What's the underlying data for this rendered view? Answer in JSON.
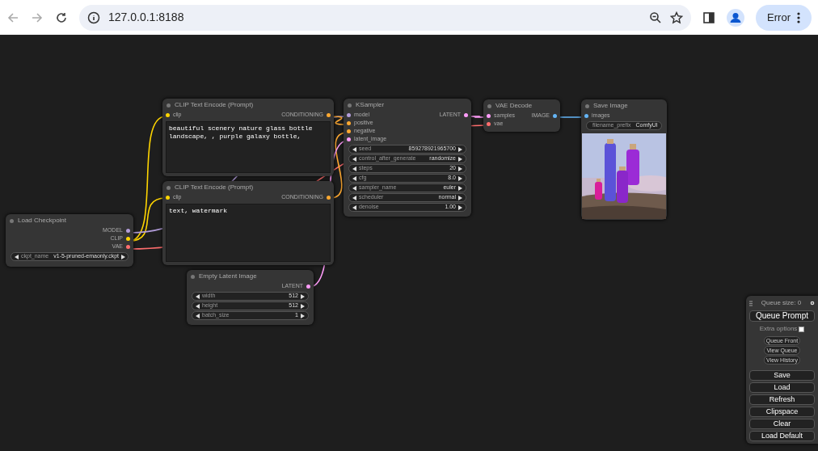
{
  "browser": {
    "url": "127.0.0.1:8188",
    "profile_button": "Error"
  },
  "nodes": [
    {
      "title": "Load Checkpoint",
      "outputs": [
        {
          "label": "MODEL",
          "color": "#b39ddb"
        },
        {
          "label": "CLIP",
          "color": "#ffd500"
        },
        {
          "label": "VAE",
          "color": "#ff6e6e"
        }
      ],
      "widgets": [
        {
          "kind": "number",
          "label": "ckpt_name",
          "value": "v1-5-pruned-emaonly.ckpt"
        }
      ]
    },
    {
      "title": "CLIP Text Encode (Prompt)",
      "inputs": [
        {
          "label": "clip",
          "color": "#ffd500"
        }
      ],
      "outputs": [
        {
          "label": "CONDITIONING",
          "color": "#ffa931"
        }
      ],
      "text": "beautiful scenery nature glass bottle landscape, , purple galaxy bottle,"
    },
    {
      "title": "CLIP Text Encode (Prompt)",
      "inputs": [
        {
          "label": "clip",
          "color": "#ffd500"
        }
      ],
      "outputs": [
        {
          "label": "CONDITIONING",
          "color": "#ffa931"
        }
      ],
      "text": "text, watermark"
    },
    {
      "title": "Empty Latent Image",
      "outputs": [
        {
          "label": "LATENT",
          "color": "#ff9cf9"
        }
      ],
      "widgets": [
        {
          "kind": "number",
          "label": "width",
          "value": "512"
        },
        {
          "kind": "number",
          "label": "height",
          "value": "512"
        },
        {
          "kind": "number",
          "label": "batch_size",
          "value": "1"
        }
      ]
    },
    {
      "title": "KSampler",
      "inputs": [
        {
          "label": "model",
          "color": "#b39ddb"
        },
        {
          "label": "positive",
          "color": "#ffa931"
        },
        {
          "label": "negative",
          "color": "#ffa931"
        },
        {
          "label": "latent_image",
          "color": "#ff9cf9"
        }
      ],
      "outputs": [
        {
          "label": "LATENT",
          "color": "#ff9cf9"
        }
      ],
      "widgets": [
        {
          "kind": "number",
          "label": "seed",
          "value": "859278921965700"
        },
        {
          "kind": "number",
          "label": "control_after_generate",
          "value": "randomize"
        },
        {
          "kind": "number",
          "label": "steps",
          "value": "20"
        },
        {
          "kind": "number",
          "label": "cfg",
          "value": "8.0"
        },
        {
          "kind": "number",
          "label": "sampler_name",
          "value": "euler"
        },
        {
          "kind": "number",
          "label": "scheduler",
          "value": "normal"
        },
        {
          "kind": "number",
          "label": "denoise",
          "value": "1.00"
        }
      ]
    },
    {
      "title": "VAE Decode",
      "inputs": [
        {
          "label": "samples",
          "color": "#ff9cf9"
        },
        {
          "label": "vae",
          "color": "#ff6e6e"
        }
      ],
      "outputs": [
        {
          "label": "IMAGE",
          "color": "#64b5f6"
        }
      ]
    },
    {
      "title": "Save Image",
      "inputs": [
        {
          "label": "images",
          "color": "#64b5f6"
        }
      ],
      "widgets": [
        {
          "kind": "text",
          "label": "filename_prefix",
          "value": "ComfyUI"
        }
      ],
      "image": {
        "kind": "picture"
      }
    }
  ],
  "queue_panel": {
    "queue_size": "Queue size: 0",
    "queue_button": "Queue Prompt",
    "extra_options": {
      "label": "Extra options",
      "checked": false
    },
    "small_buttons": [
      "Queue Front",
      "View Queue",
      "View History"
    ],
    "buttons": [
      "Save",
      "Load",
      "Refresh",
      "Clipspace",
      "Clear",
      "Load Default"
    ]
  }
}
